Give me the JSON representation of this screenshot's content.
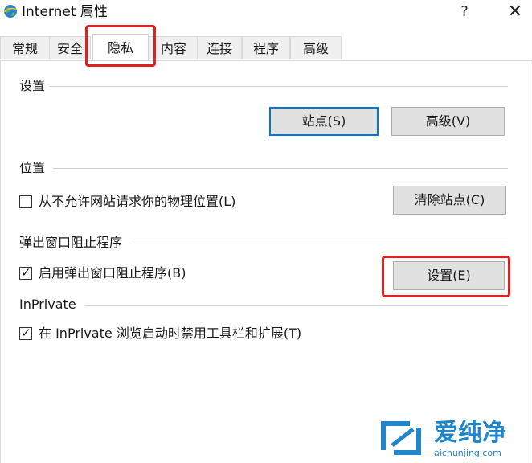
{
  "window": {
    "title": "Internet 属性",
    "help_glyph": "?",
    "close_glyph": "✕"
  },
  "tabs": [
    {
      "label": "常规"
    },
    {
      "label": "安全"
    },
    {
      "label": "隐私",
      "active": true
    },
    {
      "label": "内容"
    },
    {
      "label": "连接"
    },
    {
      "label": "程序"
    },
    {
      "label": "高级"
    }
  ],
  "settings": {
    "heading": "设置",
    "sites_button": "站点(S)",
    "advanced_button": "高级(V)"
  },
  "location": {
    "heading": "位置",
    "checkbox_label": "从不允许网站请求你的物理位置(L)",
    "checked": false,
    "clear_sites_button": "清除站点(C)"
  },
  "popup_blocker": {
    "heading": "弹出窗口阻止程序",
    "checkbox_label": "启用弹出窗口阻止程序(B)",
    "checked": true,
    "settings_button": "设置(E)"
  },
  "inprivate": {
    "heading": "InPrivate",
    "checkbox_label": "在 InPrivate 浏览启动时禁用工具栏和扩展(T)",
    "checked": true
  },
  "watermark": {
    "text": "爱纯净",
    "url": "aichunjing.com"
  },
  "colors": {
    "highlight": "#e0201f",
    "default_button_border": "#0078d7",
    "watermark": "#1f86c9"
  }
}
